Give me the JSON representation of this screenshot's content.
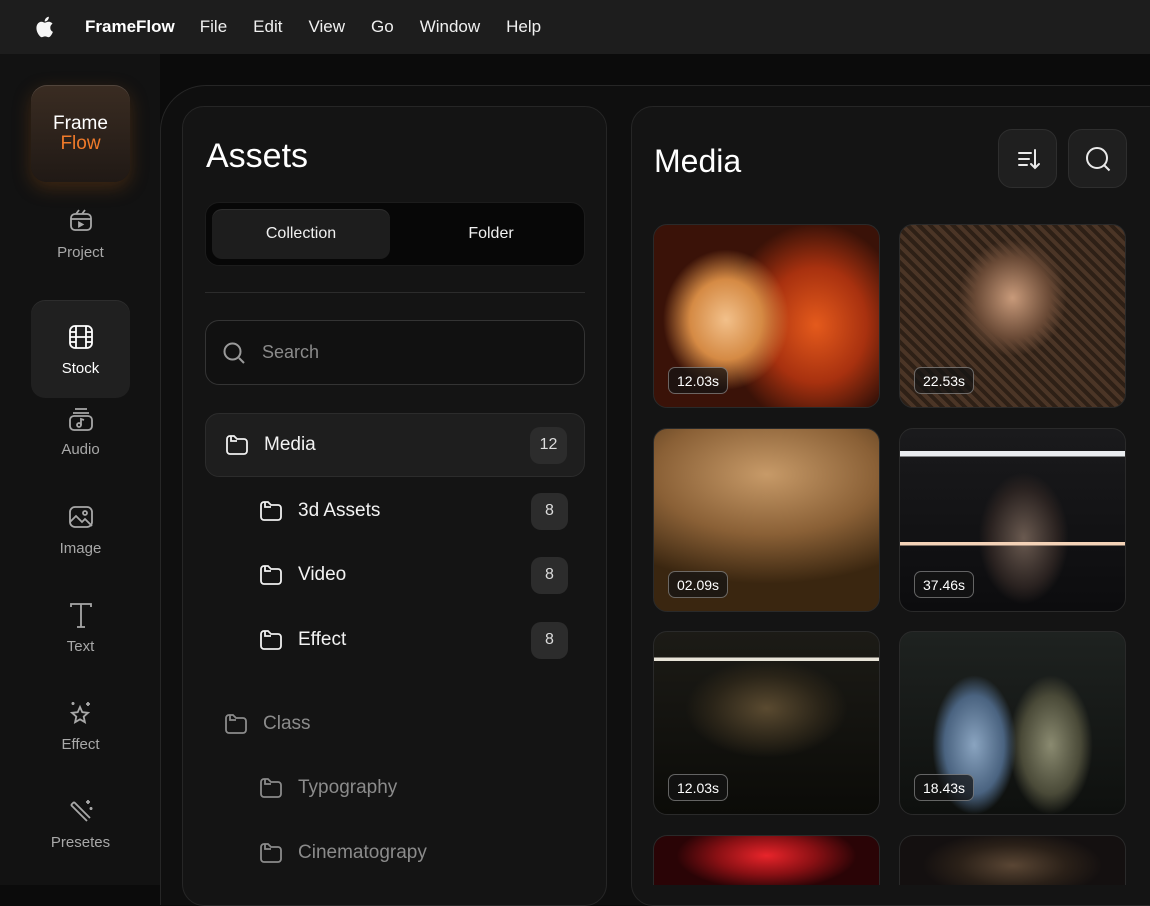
{
  "menubar": {
    "app_name": "FrameFlow",
    "items": [
      "File",
      "Edit",
      "View",
      "Go",
      "Window",
      "Help"
    ]
  },
  "logo": {
    "line1": "Frame",
    "line2": "Flow"
  },
  "rail": {
    "items": [
      {
        "label": "Project",
        "icon": "clapper-icon"
      },
      {
        "label": "Stock",
        "icon": "film-icon",
        "active": true
      },
      {
        "label": "Audio",
        "icon": "music-note-icon"
      },
      {
        "label": "Image",
        "icon": "image-icon"
      },
      {
        "label": "Text",
        "icon": "text-icon"
      },
      {
        "label": "Effect",
        "icon": "sparkle-icon"
      },
      {
        "label": "Presetes",
        "icon": "magic-wand-icon"
      }
    ]
  },
  "assets": {
    "title": "Assets",
    "tabs": [
      "Collection",
      "Folder"
    ],
    "search_placeholder": "Search",
    "tree": [
      {
        "label": "Media",
        "count": "12"
      },
      {
        "label": "3d Assets",
        "count": "8"
      },
      {
        "label": "Video",
        "count": "8"
      },
      {
        "label": "Effect",
        "count": "8"
      },
      {
        "label": "Class"
      },
      {
        "label": "Typography"
      },
      {
        "label": "Cinematograpy"
      }
    ]
  },
  "media": {
    "title": "Media",
    "thumbs": [
      {
        "duration": "12.03s"
      },
      {
        "duration": "22.53s"
      },
      {
        "duration": "02.09s"
      },
      {
        "duration": "37.46s"
      },
      {
        "duration": "12.03s"
      },
      {
        "duration": "18.43s"
      }
    ]
  }
}
